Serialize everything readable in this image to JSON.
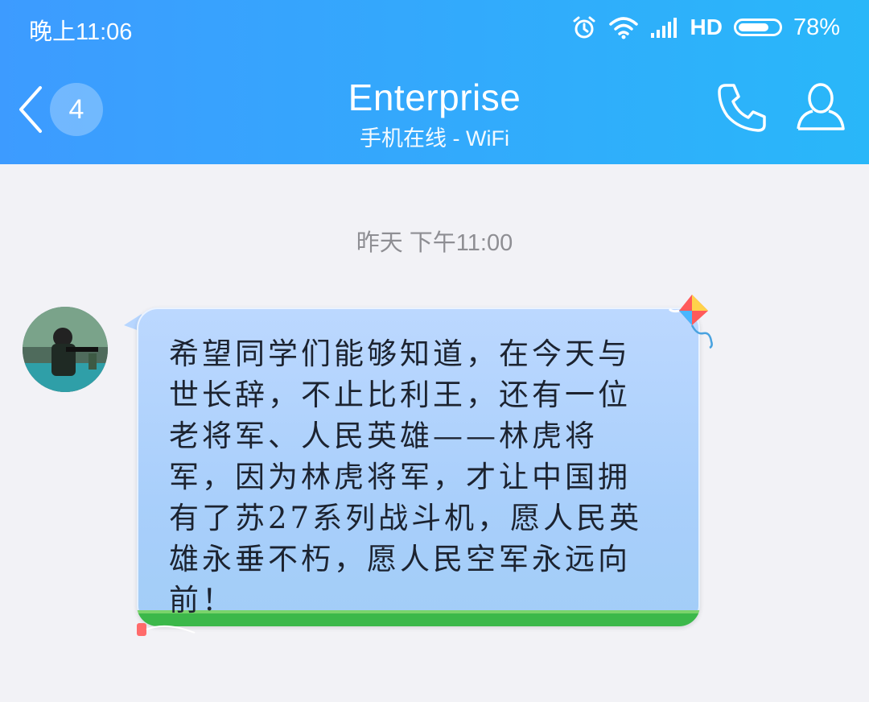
{
  "status_bar": {
    "time": "晚上11:06",
    "network_label": "HD",
    "battery_percent_text": "78%",
    "battery_level": 0.78
  },
  "header": {
    "back_icon": "chevron-left-icon",
    "unread_count": "4",
    "title": "Enterprise",
    "subtitle": "手机在线 - WiFi",
    "call_icon": "phone-icon",
    "profile_icon": "user-icon"
  },
  "chat": {
    "timestamp": "昨天 下午11:00",
    "messages": [
      {
        "sender": "contact",
        "avatar_icon": "avatar-photo",
        "text": "希望同学们能够知道，在今天与\n世长辞，不止比利王，还有一位\n老将军、人民英雄——林虎将\n军，因为林虎将军，才让中国拥\n有了苏27系列战斗机，愿人民英\n雄永垂不朽，愿人民空军永远向\n前！"
      }
    ]
  },
  "colors": {
    "header_start": "#3d9bff",
    "header_end": "#29b7f9",
    "background": "#f2f2f6",
    "bubble": "#a9cffb"
  }
}
